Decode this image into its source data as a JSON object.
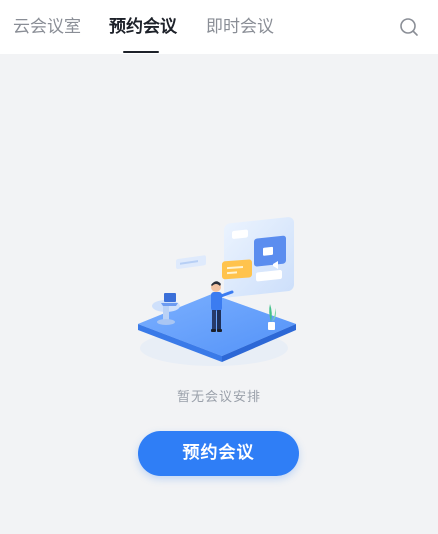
{
  "tabs": [
    {
      "label": "云会议室",
      "active": false
    },
    {
      "label": "预约会议",
      "active": true
    },
    {
      "label": "即时会议",
      "active": false
    }
  ],
  "search": {
    "icon": "search-icon"
  },
  "empty_state": {
    "message": "暂无会议安排",
    "illustration": "meeting-illustration"
  },
  "primary_button": {
    "label": "预约会议"
  },
  "colors": {
    "accent": "#2f7ef6",
    "background": "#f2f3f5",
    "active_tab": "#1d2129",
    "inactive_tab": "#8a8e96"
  }
}
